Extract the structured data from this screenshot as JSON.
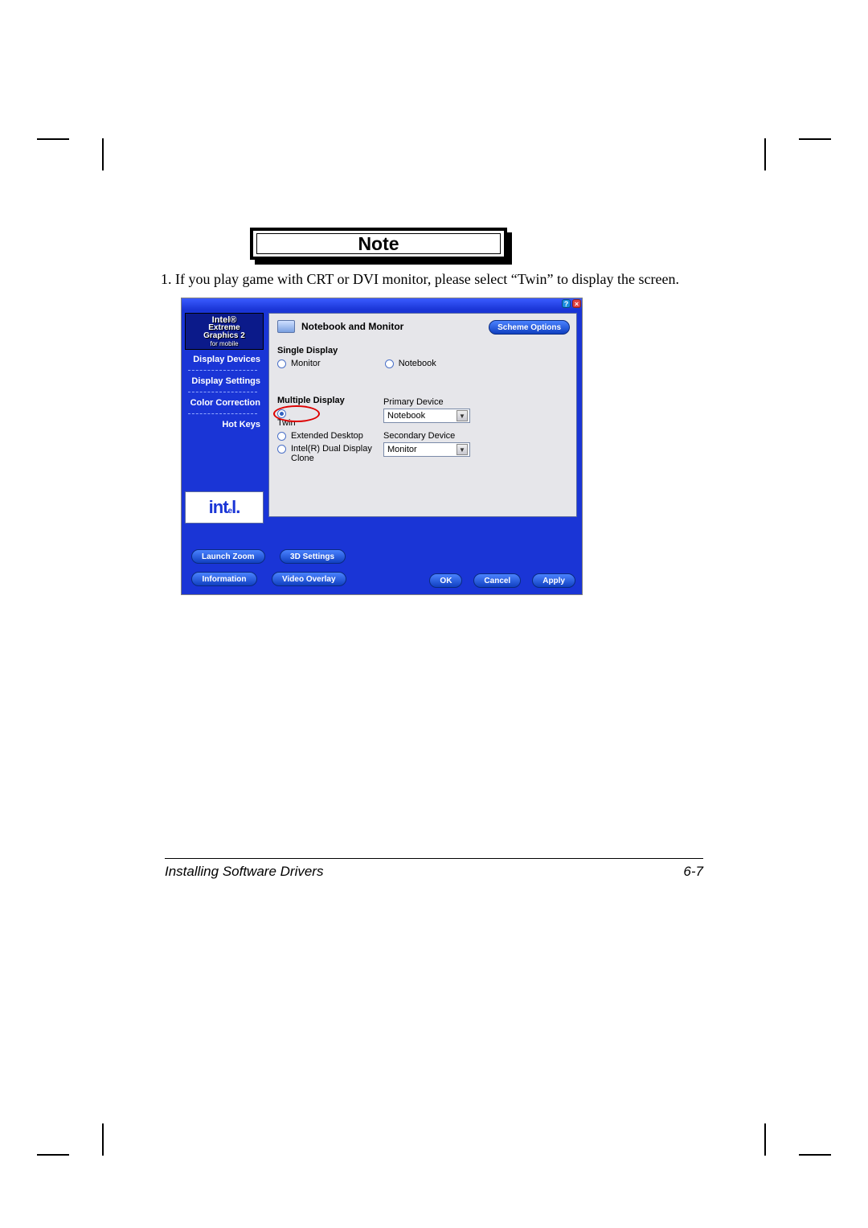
{
  "note_heading": "Note",
  "note_item": "1. If you play game with CRT or DVI monitor, please select “Twin” to display the screen.",
  "window": {
    "product": {
      "l1": "Intel®",
      "l2": "Extreme",
      "l3": "Graphics 2",
      "l4": "for mobile"
    },
    "sidebar": [
      "Display Devices",
      "Display Settings",
      "Color Correction",
      "Hot Keys"
    ],
    "intel_logo": "intel.",
    "header_title": "Notebook and Monitor",
    "scheme_btn": "Scheme Options",
    "single_display": {
      "title": "Single Display",
      "options": [
        "Monitor",
        "Notebook"
      ]
    },
    "multiple_display": {
      "title": "Multiple Display",
      "options": [
        "Twin",
        "Extended Desktop",
        "Intel(R) Dual Display Clone"
      ],
      "primary_label": "Primary Device",
      "primary_value": "Notebook",
      "secondary_label": "Secondary Device",
      "secondary_value": "Monitor"
    },
    "bottom_left": [
      "Launch Zoom",
      "3D Settings",
      "Information",
      "Video Overlay"
    ],
    "bottom_right": [
      "OK",
      "Cancel",
      "Apply"
    ]
  },
  "footer": {
    "left": "Installing Software Drivers",
    "right": "6-7"
  }
}
